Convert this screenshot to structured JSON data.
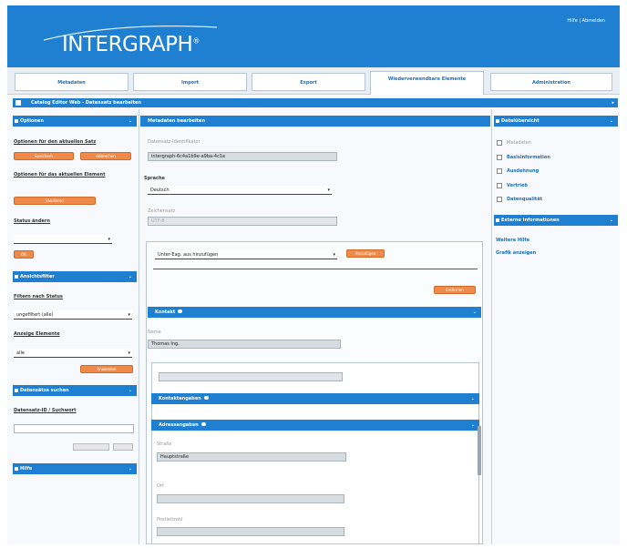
{
  "header": {
    "logo_text": "INTERGRAPH",
    "logo_mark": "®",
    "user_links": "Hilfe | Abmelden",
    "bg_color": "#1f7fd1"
  },
  "nav": {
    "tabs": [
      {
        "label": "Metadaten"
      },
      {
        "label": "Import"
      },
      {
        "label": "Export"
      },
      {
        "label": "Wiederverwendbare Elemente"
      },
      {
        "label": "Administration"
      }
    ]
  },
  "breadcrumb": {
    "text": "Catalog Editor Web - Datensatz bearbeiten"
  },
  "left": {
    "options_title": "Optionen",
    "options_current_set": "Optionen für den aktuellen Satz",
    "btn_save": "Speichern",
    "btn_cancel": "Abbrechen",
    "options_current_element": "Optionen für das aktuellen Element",
    "btn_validate": "Validieren",
    "status_change": "Status ändern",
    "status_value": "",
    "btn_ok": "OK",
    "view_title": "Ansichtsfilter",
    "filter_by_status": "Filtern nach Status",
    "filter_status_value": "ungefiltert (alle)",
    "filter_by_element": "Anzeige Elemente",
    "filter_element_value": "alle",
    "btn_apply": "Anwenden",
    "search_title": "Datensätze suchen",
    "search_label": "Datensatz-ID / Suchwort",
    "search_value": "",
    "help_title": "Hilfe"
  },
  "center": {
    "title": "Metadaten bearbeiten",
    "field1_label": "Datensatz-Identifikator",
    "field1_value": "intergraph-6c4a1b9e-a9ba-4c1e",
    "language_label": "Sprache",
    "language_value": "Deutsch",
    "field3_label": "Zeichensatz",
    "field3_value": "UTF-8",
    "select_value": "Unter-Eag. aus hinzufügen",
    "btn_add": "Hinzufügen",
    "btn_remove": "Entfernen",
    "sub1_title": "Kontakt",
    "sub1_field_label": "Name",
    "sub1_field_value": "Thomas Ing.",
    "sub1_light_value": "",
    "sub2_title": "Kontaktangaben",
    "sub3_title": "Adressangaben",
    "sub3_field1_label": "Straße",
    "sub3_field1_value": "Hauptstraße",
    "sub3_field2_label": "Ort",
    "sub3_field3_label": "Postleitzahl"
  },
  "right": {
    "title": "Dateiübersicht",
    "checkbox_label": "Metadaten",
    "items": [
      {
        "label": "Basisinformation"
      },
      {
        "label": "Ausdehnung"
      },
      {
        "label": "Vertrieb"
      },
      {
        "label": "Datenqualität"
      }
    ],
    "ext_title": "Externe Informationen",
    "links": [
      {
        "label": "Weitere Hilfe"
      },
      {
        "label": "Grafik anzeigen"
      }
    ]
  }
}
